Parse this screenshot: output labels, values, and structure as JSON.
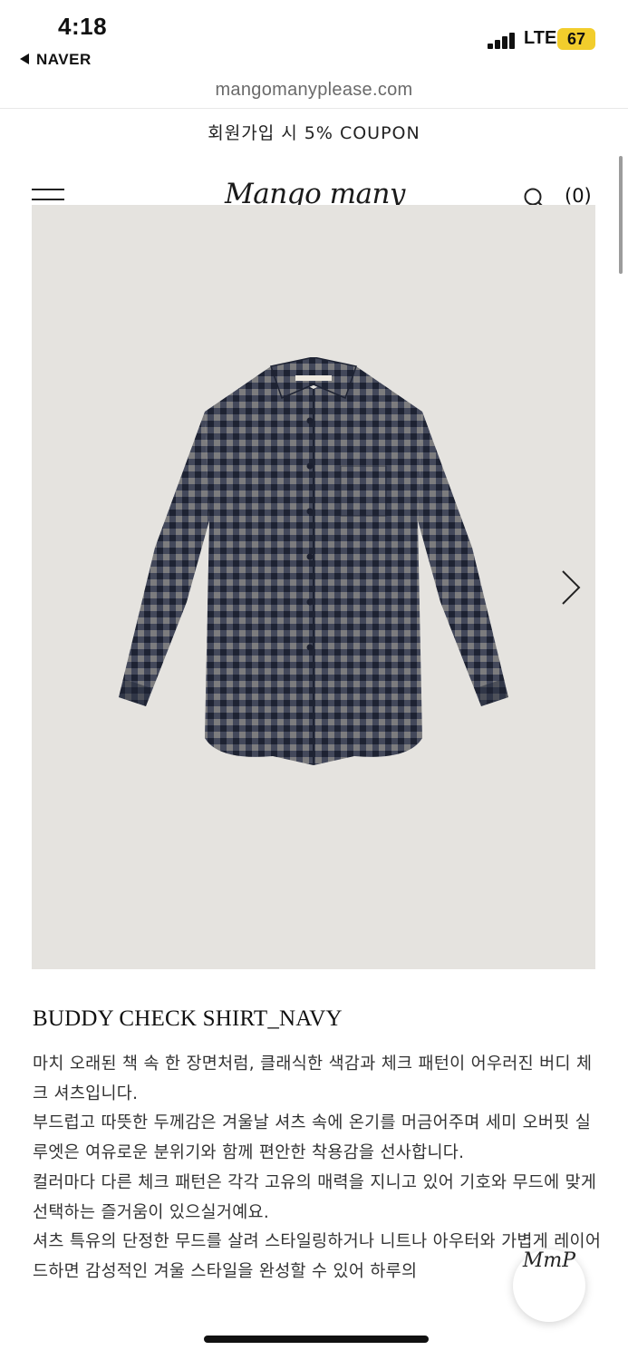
{
  "status_bar": {
    "time": "4:18",
    "back_app": "NAVER",
    "network": "LTE",
    "battery": "67"
  },
  "browser": {
    "url": "mangomanyplease.com"
  },
  "promo": {
    "coupon_text": "회원가입 시 5% COUPON"
  },
  "header": {
    "logo": "Mango many Please",
    "cart": "(0)",
    "icons": [
      "menu-icon",
      "search-icon"
    ]
  },
  "product": {
    "title": "BUDDY CHECK SHIRT_NAVY",
    "description": [
      "마치 오래된 책 속 한 장면처럼, 클래식한 색감과 체크 패턴이 어우러진 버디 체크 셔츠입니다.",
      "부드럽고 따뜻한 두께감은 겨울날 셔츠 속에 온기를 머금어주며 세미 오버핏 실루엣은 여유로운 분위기와 함께 편안한 착용감을 선사합니다.",
      "컬러마다 다른 체크 패턴은 각각 고유의 매력을 지니고 있어 기호와 무드에 맞게 선택하는 즐거움이 있으실거예요.",
      "셔츠 특유의 단정한 무드를 살려 스타일링하거나 니트나 아우터와 가볍게 레이어드하면 감성적인 겨울 스타일을 완성할 수 있어 하루의"
    ],
    "image_icons": [
      "next-arrow-icon"
    ]
  },
  "floating_badge": {
    "text": "MmP"
  },
  "colors": {
    "hero_bg": "#e5e3df",
    "battery": "#f2cd2c",
    "shirt_navy": "#2b3142",
    "shirt_grey": "#7c7c7e"
  }
}
